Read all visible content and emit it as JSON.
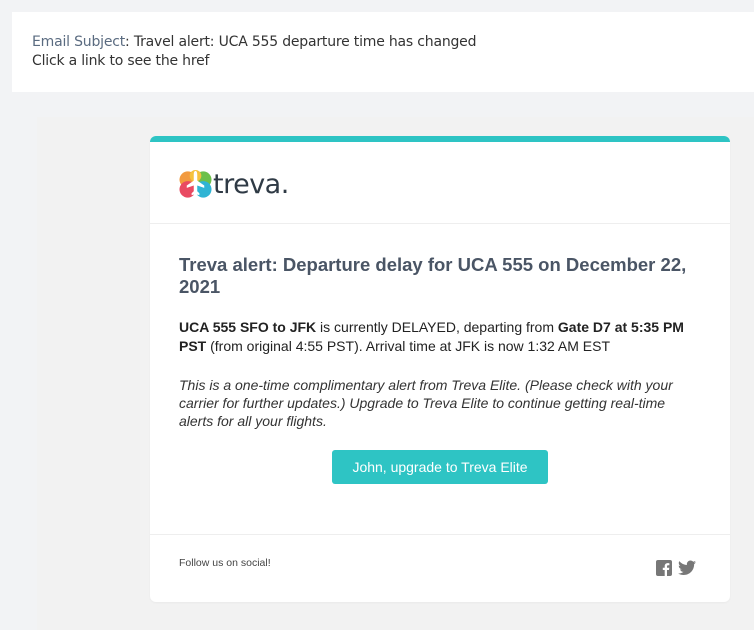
{
  "email": {
    "subject_label": "Email Subject",
    "subject_value": "Travel alert: UCA 555 departure time has changed",
    "hint": "Click a link to see the href"
  },
  "brand": {
    "name": "treva.",
    "accent_color": "#2ec4c4",
    "logo_icon": "airplane-logo-icon"
  },
  "alert": {
    "title": "Treva alert: Departure delay for UCA 555 on December 22, 2021",
    "flight_route": "UCA 555 SFO to JFK",
    "status_text": " is currently DELAYED, departing from ",
    "gate_time": "Gate D7 at 5:35 PM PST",
    "original_text": " (from original 4:55 PST). Arrival time at JFK is now 1:32 AM EST",
    "promo": "This is a one-time complimentary alert from Treva Elite. (Please check with your carrier for further updates.) Upgrade to Treva Elite to continue getting real-time alerts for all your flights.",
    "cta_label": "John, upgrade to Treva Elite"
  },
  "footer": {
    "follow_text": "Follow us on social!",
    "social_icons": [
      "facebook-icon",
      "twitter-icon"
    ]
  }
}
